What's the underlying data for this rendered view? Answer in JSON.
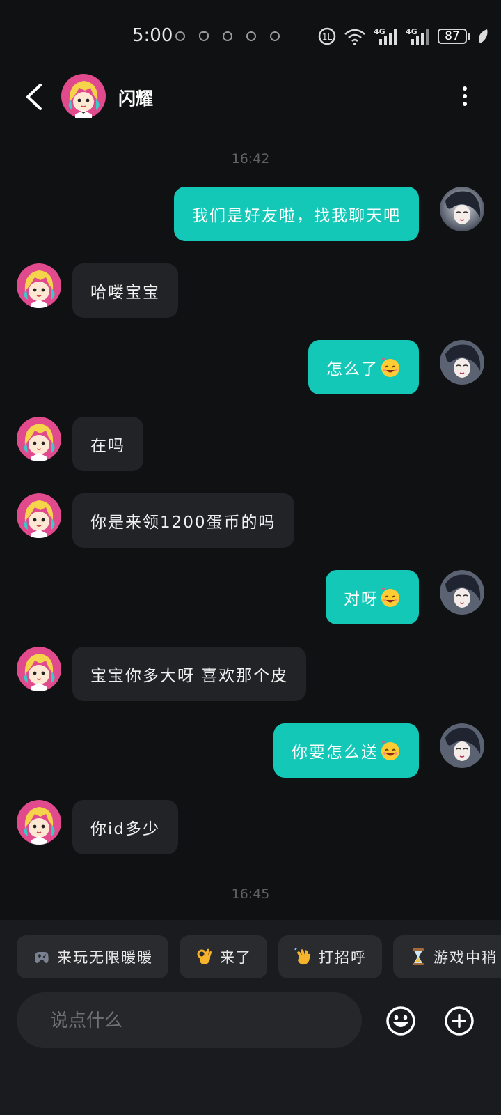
{
  "status_bar": {
    "time": "5:00",
    "battery": "87",
    "network1": "4G",
    "network2": "4G"
  },
  "header": {
    "contact_name": "闪耀"
  },
  "timestamps": [
    "16:42",
    "16:45"
  ],
  "messages": [
    {
      "side": "out",
      "text": "我们是好友啦，找我聊天吧",
      "emoji": false
    },
    {
      "side": "in",
      "text": "哈喽宝宝",
      "emoji": false
    },
    {
      "side": "out",
      "text": "怎么了",
      "emoji": true
    },
    {
      "side": "in",
      "text": "在吗",
      "emoji": false
    },
    {
      "side": "in",
      "text": "你是来领1200蛋币的吗",
      "emoji": false
    },
    {
      "side": "out",
      "text": "对呀",
      "emoji": true
    },
    {
      "side": "in",
      "text": "宝宝你多大呀 喜欢那个皮",
      "emoji": false
    },
    {
      "side": "out",
      "text": "你要怎么送",
      "emoji": true
    },
    {
      "side": "in",
      "text": "你id多少",
      "emoji": false
    }
  ],
  "quick_replies": [
    {
      "icon": "gamepad-icon",
      "label": "来玩无限暖暖"
    },
    {
      "icon": "ok-hand-icon",
      "label": "来了"
    },
    {
      "icon": "wave-hand-icon",
      "label": "打招呼"
    },
    {
      "icon": "hourglass-icon",
      "label": "游戏中稍"
    }
  ],
  "input": {
    "placeholder": "说点什么"
  },
  "colors": {
    "outgoing_bubble": "#14c8b8",
    "incoming_bubble": "#222326",
    "background": "#101112"
  }
}
